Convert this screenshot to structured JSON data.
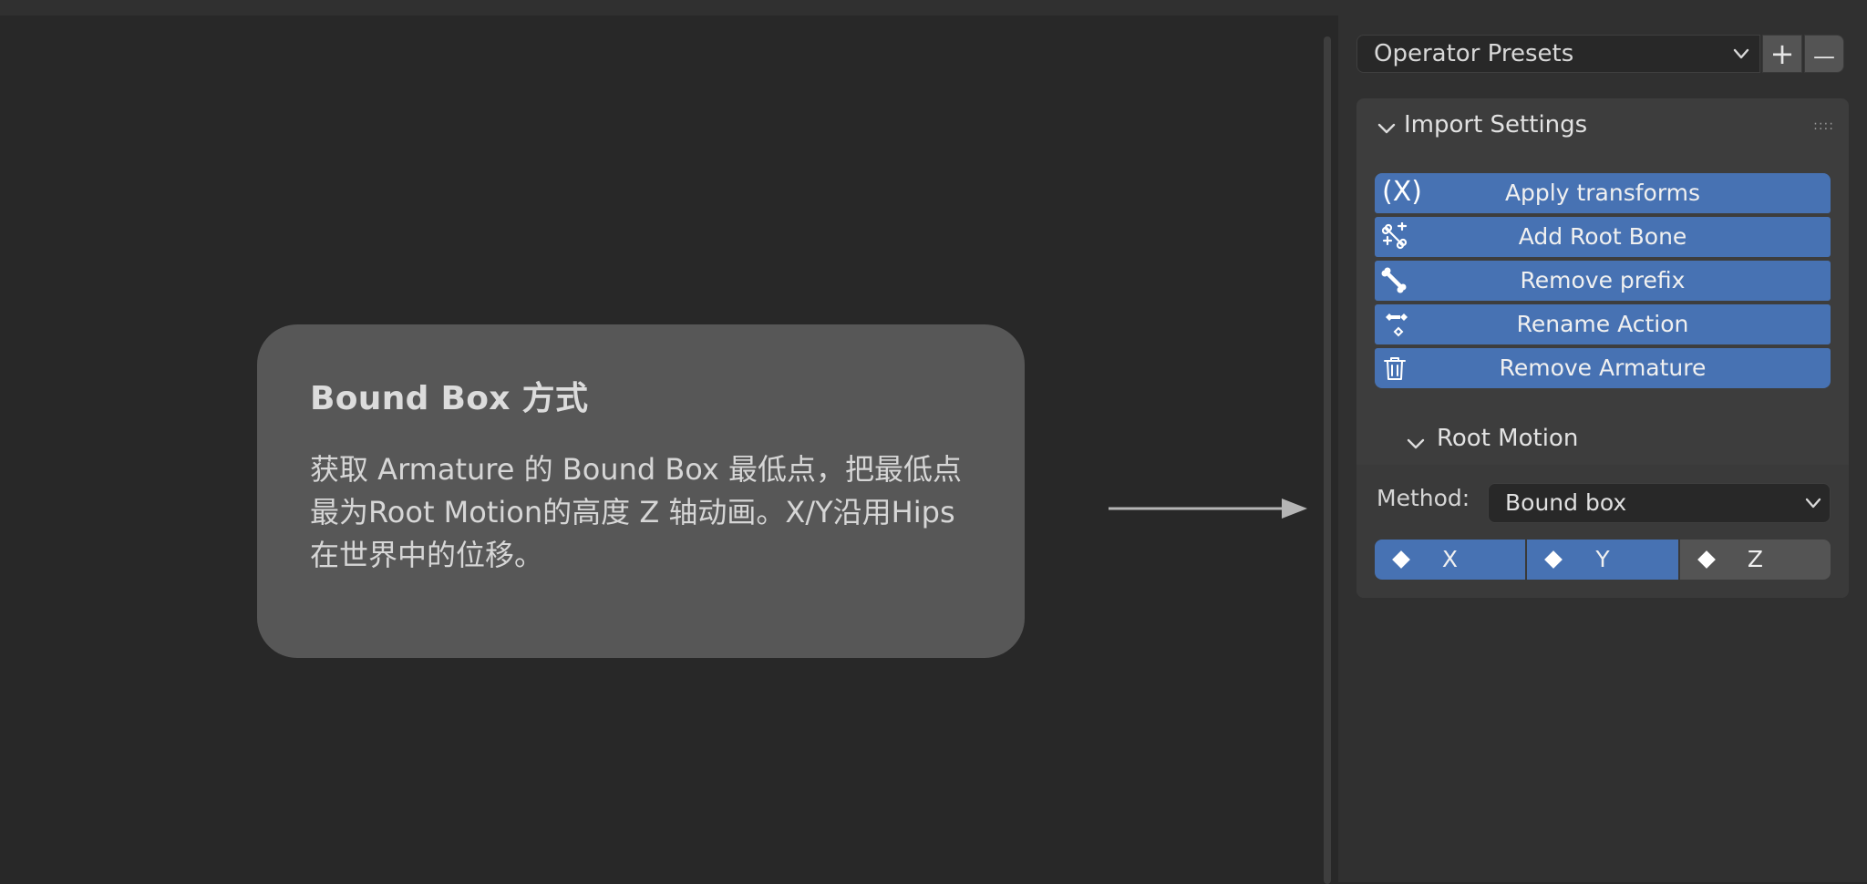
{
  "tooltip": {
    "title": "Bound Box 方式",
    "body": "获取 Armature 的 Bound Box 最低点，把最低点最为Root Motion的高度 Z 轴动画。X/Y沿用Hips在世界中的位移。"
  },
  "presets": {
    "label": "Operator Presets",
    "add": "+",
    "remove": "—"
  },
  "panel": {
    "title": "Import Settings",
    "grip": "::::",
    "buttons": [
      {
        "label": "Apply transforms",
        "icon": "function-x-icon"
      },
      {
        "label": "Add Root Bone",
        "icon": "bone-add-icon"
      },
      {
        "label": "Remove prefix",
        "icon": "bone-icon"
      },
      {
        "label": "Rename Action",
        "icon": "action-keyframes-icon"
      },
      {
        "label": "Remove Armature",
        "icon": "trash-icon"
      }
    ],
    "function_glyph": "(X)",
    "root_motion": {
      "title": "Root Motion",
      "method_label": "Method:",
      "method_value": "Bound box",
      "axes": [
        {
          "label": "X",
          "active": true
        },
        {
          "label": "Y",
          "active": true
        },
        {
          "label": "Z",
          "active": false
        }
      ]
    }
  },
  "colors": {
    "accent": "#4772b3",
    "panel": "#3d3d3d",
    "background": "#282828",
    "tooltip": "#575757"
  }
}
